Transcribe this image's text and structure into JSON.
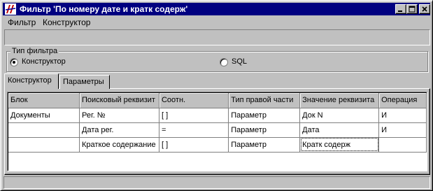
{
  "window": {
    "title": "Фильтр 'По номеру дате и кратк содерж'",
    "colors": {
      "titlebar": "#000080",
      "face": "#c0c0c0"
    }
  },
  "menu": {
    "items": [
      {
        "label": "Фильтр"
      },
      {
        "label": "Конструктор"
      }
    ]
  },
  "filter_type": {
    "legend": "Тип фильтра",
    "options": [
      {
        "label": "Конструктор",
        "selected": true
      },
      {
        "label": "SQL",
        "selected": false
      }
    ]
  },
  "tabs": [
    {
      "label": "Конструктор",
      "active": true
    },
    {
      "label": "Параметры",
      "active": false
    }
  ],
  "grid": {
    "columns": [
      "Блок",
      "Поисковый реквизит",
      "Соотн.",
      "Тип правой части",
      "Значение реквизита",
      "Операция"
    ],
    "rows": [
      [
        "Документы",
        "Рег. №",
        "[ ]",
        "Параметр",
        "Док N",
        "И"
      ],
      [
        "",
        "Дата рег.",
        "=",
        "Параметр",
        "Дата",
        "И"
      ],
      [
        "",
        "Краткое содержание",
        "[ ]",
        "Параметр",
        "Кратк содерж",
        ""
      ]
    ]
  }
}
